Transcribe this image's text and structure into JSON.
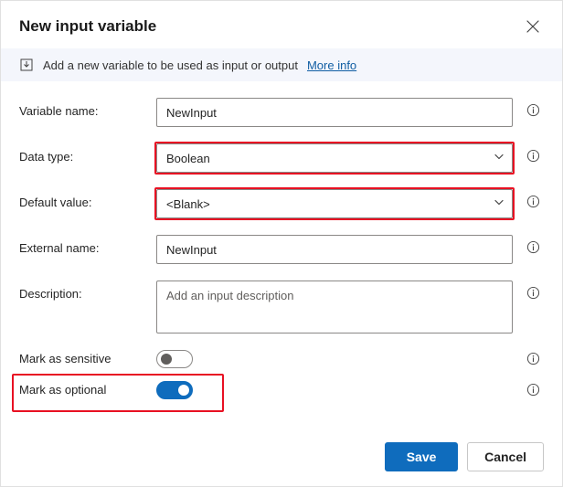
{
  "header": {
    "title": "New input variable"
  },
  "banner": {
    "text": "Add a new variable to be used as input or output",
    "link_label": "More info"
  },
  "fields": {
    "variable_name": {
      "label": "Variable name:",
      "value": "NewInput"
    },
    "data_type": {
      "label": "Data type:",
      "value": "Boolean"
    },
    "default_value": {
      "label": "Default value:",
      "value": "<Blank>"
    },
    "external_name": {
      "label": "External name:",
      "value": "NewInput"
    },
    "description": {
      "label": "Description:",
      "placeholder": "Add an input description"
    },
    "mark_sensitive": {
      "label": "Mark as sensitive",
      "on": false
    },
    "mark_optional": {
      "label": "Mark as optional",
      "on": true
    }
  },
  "footer": {
    "save_label": "Save",
    "cancel_label": "Cancel"
  }
}
